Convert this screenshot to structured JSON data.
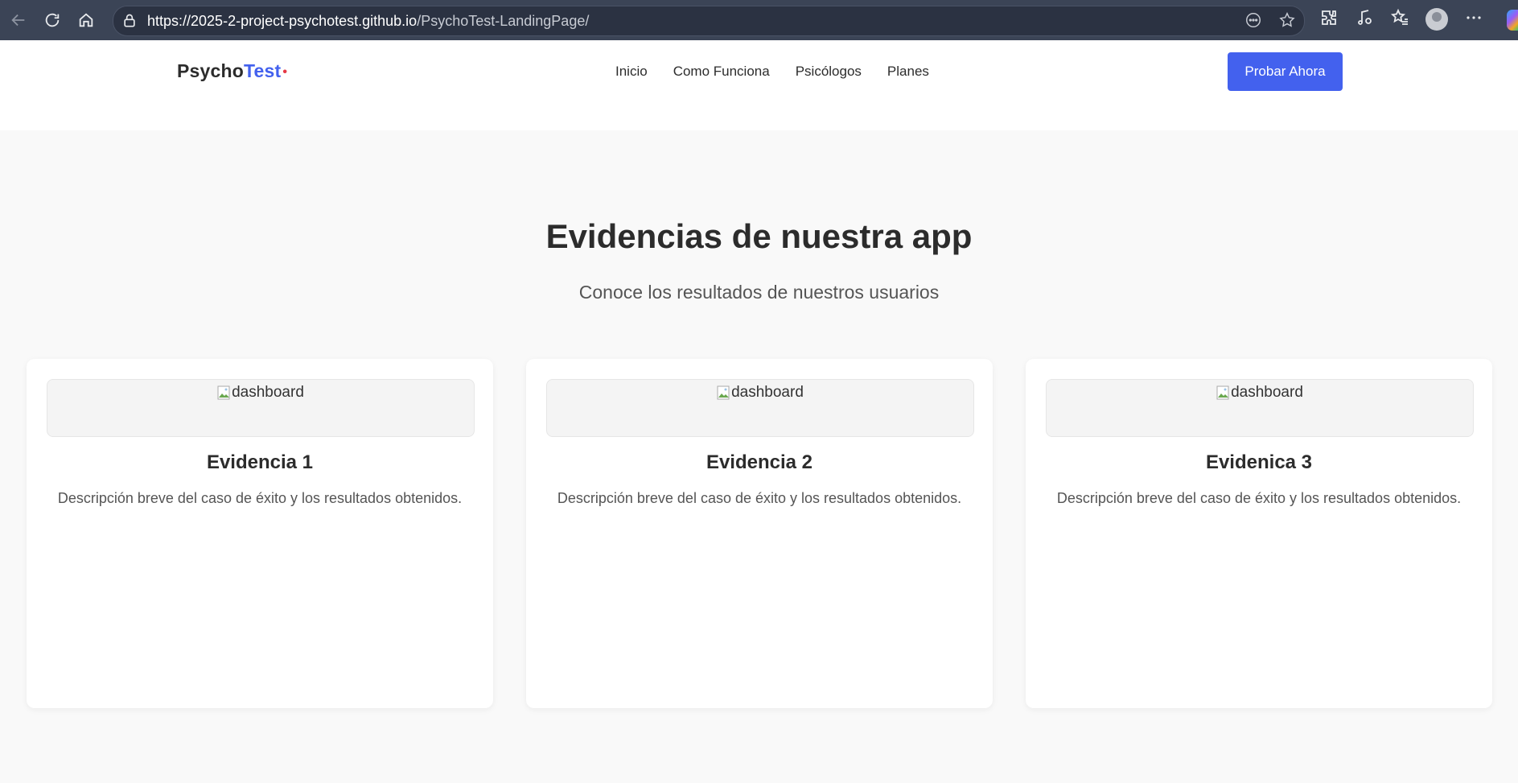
{
  "browser": {
    "url_host": "https://2025-2-project-psychotest.github.io",
    "url_path": "/PsychoTest-LandingPage/"
  },
  "header": {
    "logo_part1": "Psycho",
    "logo_part2": "Test",
    "logo_dot": "•",
    "nav": [
      "Inicio",
      "Como Funciona",
      "Psicólogos",
      "Planes"
    ],
    "cta_label": "Probar Ahora"
  },
  "section": {
    "title": "Evidencias de nuestra app",
    "subtitle": "Conoce los resultados de nuestros usuarios"
  },
  "cards": [
    {
      "img_alt": "dashboard",
      "title": "Evidencia 1",
      "desc": "Descripción breve del caso de éxito y los resultados obtenidos."
    },
    {
      "img_alt": "dashboard",
      "title": "Evidencia 2",
      "desc": "Descripción breve del caso de éxito y los resultados obtenidos."
    },
    {
      "img_alt": "dashboard",
      "title": "Evidenica 3",
      "desc": "Descripción breve del caso de éxito y los resultados obtenidos."
    }
  ],
  "colors": {
    "accent": "#4361ee",
    "dot": "#e63946",
    "chrome": "#3b4456"
  }
}
